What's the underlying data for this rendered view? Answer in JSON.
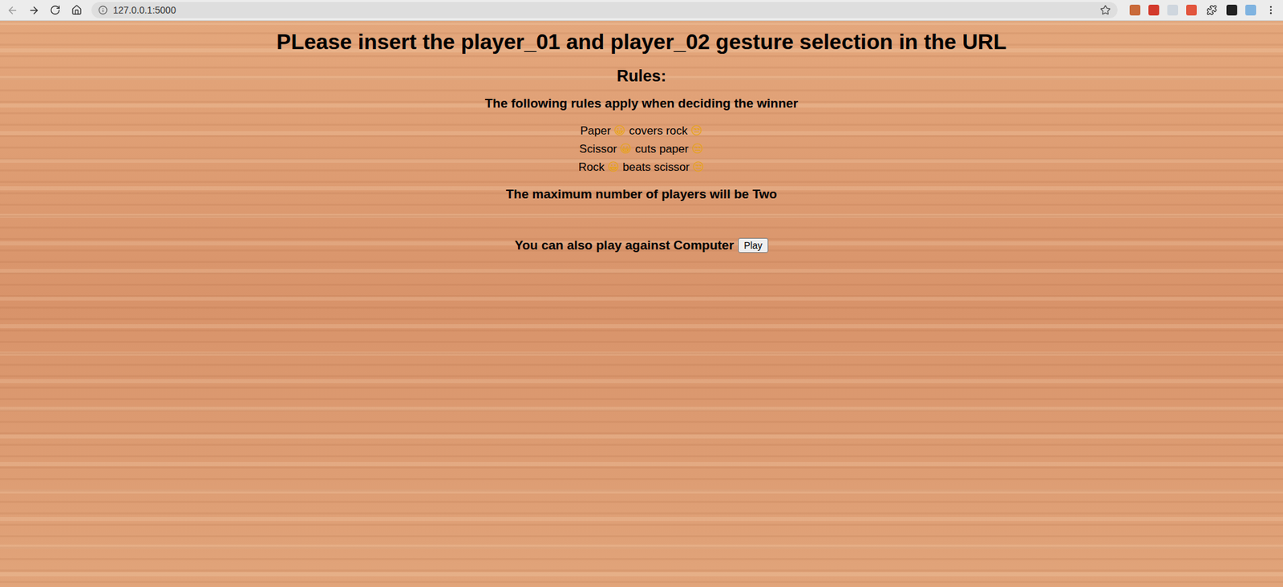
{
  "browser": {
    "url": "127.0.0.1:5000"
  },
  "page": {
    "heading": "PLease insert the player_01 and player_02 gesture selection in the URL",
    "rules_title": "Rules:",
    "rules_intro": "The following rules apply when deciding the winner",
    "rules": [
      {
        "winner": "Paper",
        "winner_face": "😀",
        "verb": "covers",
        "loser": "rock",
        "loser_face": "😒"
      },
      {
        "winner": "Scissor",
        "winner_face": "😀",
        "verb": "cuts",
        "loser": "paper",
        "loser_face": "😒"
      },
      {
        "winner": "Rock",
        "winner_face": "😀",
        "verb": "beats",
        "loser": "scissor",
        "loser_face": "😒"
      }
    ],
    "max_players": "The maximum number of players will be Two",
    "computer_prompt": "You can also play against Computer",
    "play_button": "Play"
  }
}
